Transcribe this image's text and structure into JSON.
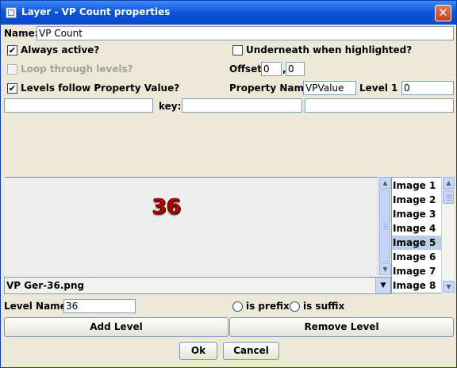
{
  "window": {
    "title": "Layer - VP Count properties",
    "close_glyph": "✕"
  },
  "name": {
    "label": "Name:",
    "value": "VP Count"
  },
  "always_active": {
    "label": "Always active?",
    "checked": true
  },
  "underneath": {
    "label": "Underneath when highlighted?",
    "checked": false
  },
  "loop": {
    "label": "Loop through levels?",
    "checked": false
  },
  "offset": {
    "label": "Offset:",
    "x": "0",
    "sep": ",",
    "y": "0"
  },
  "levels_follow": {
    "label": "Levels follow Property Value?",
    "checked": true
  },
  "property": {
    "label": "Property Name:",
    "value": "VPValue"
  },
  "level1": {
    "label": "Level 1 =",
    "value": "0"
  },
  "key": {
    "label": "key:",
    "left_value": "",
    "value": "",
    "right_value": ""
  },
  "preview": {
    "text": "36"
  },
  "images": [
    "Image 1",
    "Image 2",
    "Image 3",
    "Image 4",
    "Image 5",
    "Image 6",
    "Image 7",
    "Image 8"
  ],
  "selected_image": "Image 5",
  "image_file": "VP Ger-36.png",
  "level_name": {
    "label": "Level Name:",
    "value": "36"
  },
  "radio": {
    "prefix": "is prefix",
    "suffix": "is suffix"
  },
  "buttons": {
    "add": "Add Level",
    "remove": "Remove Level",
    "ok": "Ok",
    "cancel": "Cancel"
  },
  "colors": {
    "titlebar": "#0a53d8",
    "selection": "#b8cfe5",
    "preview_text": "#b00000"
  }
}
